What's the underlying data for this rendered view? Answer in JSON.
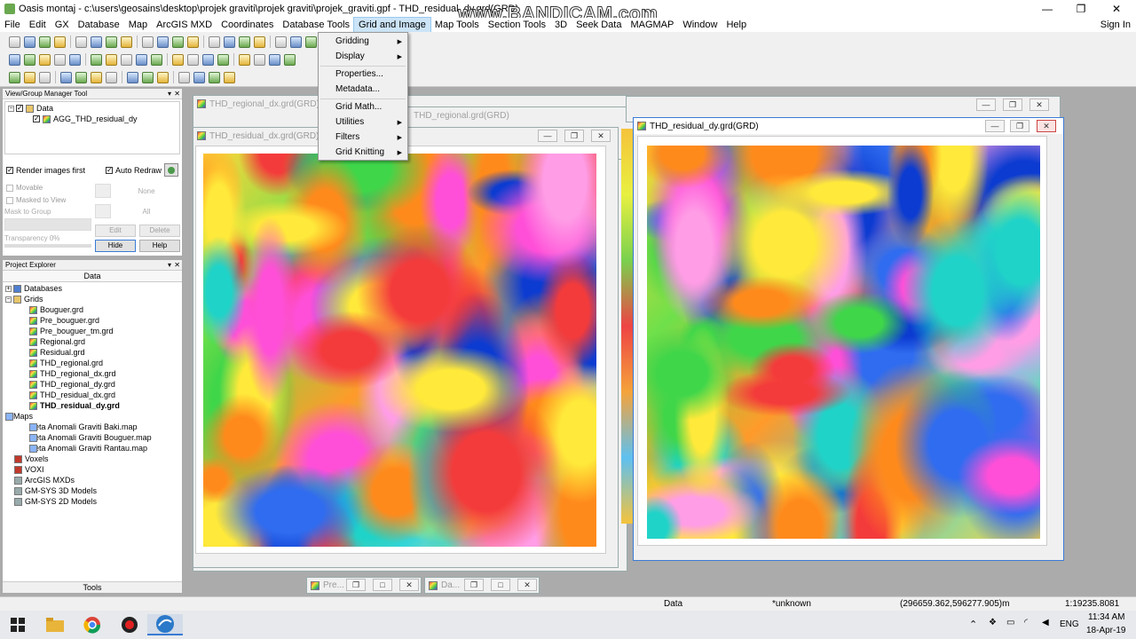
{
  "window": {
    "title": "Oasis montaj - c:\\users\\geosains\\desktop\\projek graviti\\projek graviti\\projek_graviti.gpf - THD_residual_dy.grd(GRD)",
    "watermark": "www.BANDICAM.com",
    "minimize": "—",
    "maximize": "❐",
    "close": "✕"
  },
  "menu": {
    "items": [
      "File",
      "Edit",
      "GX",
      "Database",
      "Map",
      "ArcGIS MXD",
      "Coordinates",
      "Database Tools",
      "Grid and Image",
      "Map Tools",
      "Section Tools",
      "3D",
      "Seek Data",
      "MAGMAP",
      "Window",
      "Help"
    ],
    "active": "Grid and Image",
    "signin": "Sign In"
  },
  "dropdown": {
    "items": [
      {
        "label": "Gridding",
        "submenu": true
      },
      {
        "label": "Display",
        "submenu": true
      },
      {
        "label": "Properties...",
        "submenu": false
      },
      {
        "label": "Metadata...",
        "submenu": false
      },
      {
        "label": "Grid Math...",
        "submenu": false
      },
      {
        "label": "Utilities",
        "submenu": true
      },
      {
        "label": "Filters",
        "submenu": true
      },
      {
        "label": "Grid Knitting",
        "submenu": true
      }
    ]
  },
  "view_group": {
    "header": "View/Group Manager Tool",
    "tree_root": "Data",
    "tree_child": "AGG_THD_residual_dy",
    "render_images_first": "Render images first",
    "auto_redraw": "Auto Redraw",
    "movable": "Movable",
    "masked_to_view": "Masked to View",
    "mask_to_group": "Mask to Group",
    "none_value": "None",
    "all_value": "All",
    "transparency": "Transparency 0%",
    "edit": "Edit",
    "delete": "Delete",
    "hide": "Hide",
    "help": "Help"
  },
  "project_explorer": {
    "header": "Project Explorer",
    "tab": "Data",
    "databases": "Databases",
    "grids": "Grids",
    "grid_items": [
      "Bouguer.grd",
      "Pre_bouguer.grd",
      "Pre_bouguer_tm.grd",
      "Regional.grd",
      "Residual.grd",
      "THD_regional.grd",
      "THD_regional_dx.grd",
      "THD_regional_dy.grd",
      "THD_residual_dx.grd",
      "THD_residual_dy.grd"
    ],
    "bold_item": "THD_residual_dy.grd",
    "maps": "Maps",
    "map_items": [
      "Peta Anomali Graviti Baki.map",
      "Peta Anomali Graviti Bouguer.map",
      "Peta Anomali Graviti Rantau.map"
    ],
    "others": [
      "Voxels",
      "VOXI",
      "ArcGIS MXDs",
      "GM-SYS 3D Models",
      "GM-SYS 2D Models"
    ],
    "footer": "Tools"
  },
  "windows": {
    "regional_dx": "THD_regional_dx.grd(GRD)",
    "regional_grd": "THD_regional.grd(GRD)",
    "residual_dx": "THD_residual_dx.grd(GRD)",
    "residual_dy": "THD_residual_dy.grd(GRD)",
    "min1": "Pre...",
    "min2": "Da..."
  },
  "status": {
    "data": "Data",
    "unknown": "*unknown",
    "coords": "(296659.362,596277.905)m",
    "scale": "1:19235.8081"
  },
  "taskbar": {
    "lang": "ENG",
    "time": "11:34 AM",
    "date": "18-Apr-19"
  }
}
